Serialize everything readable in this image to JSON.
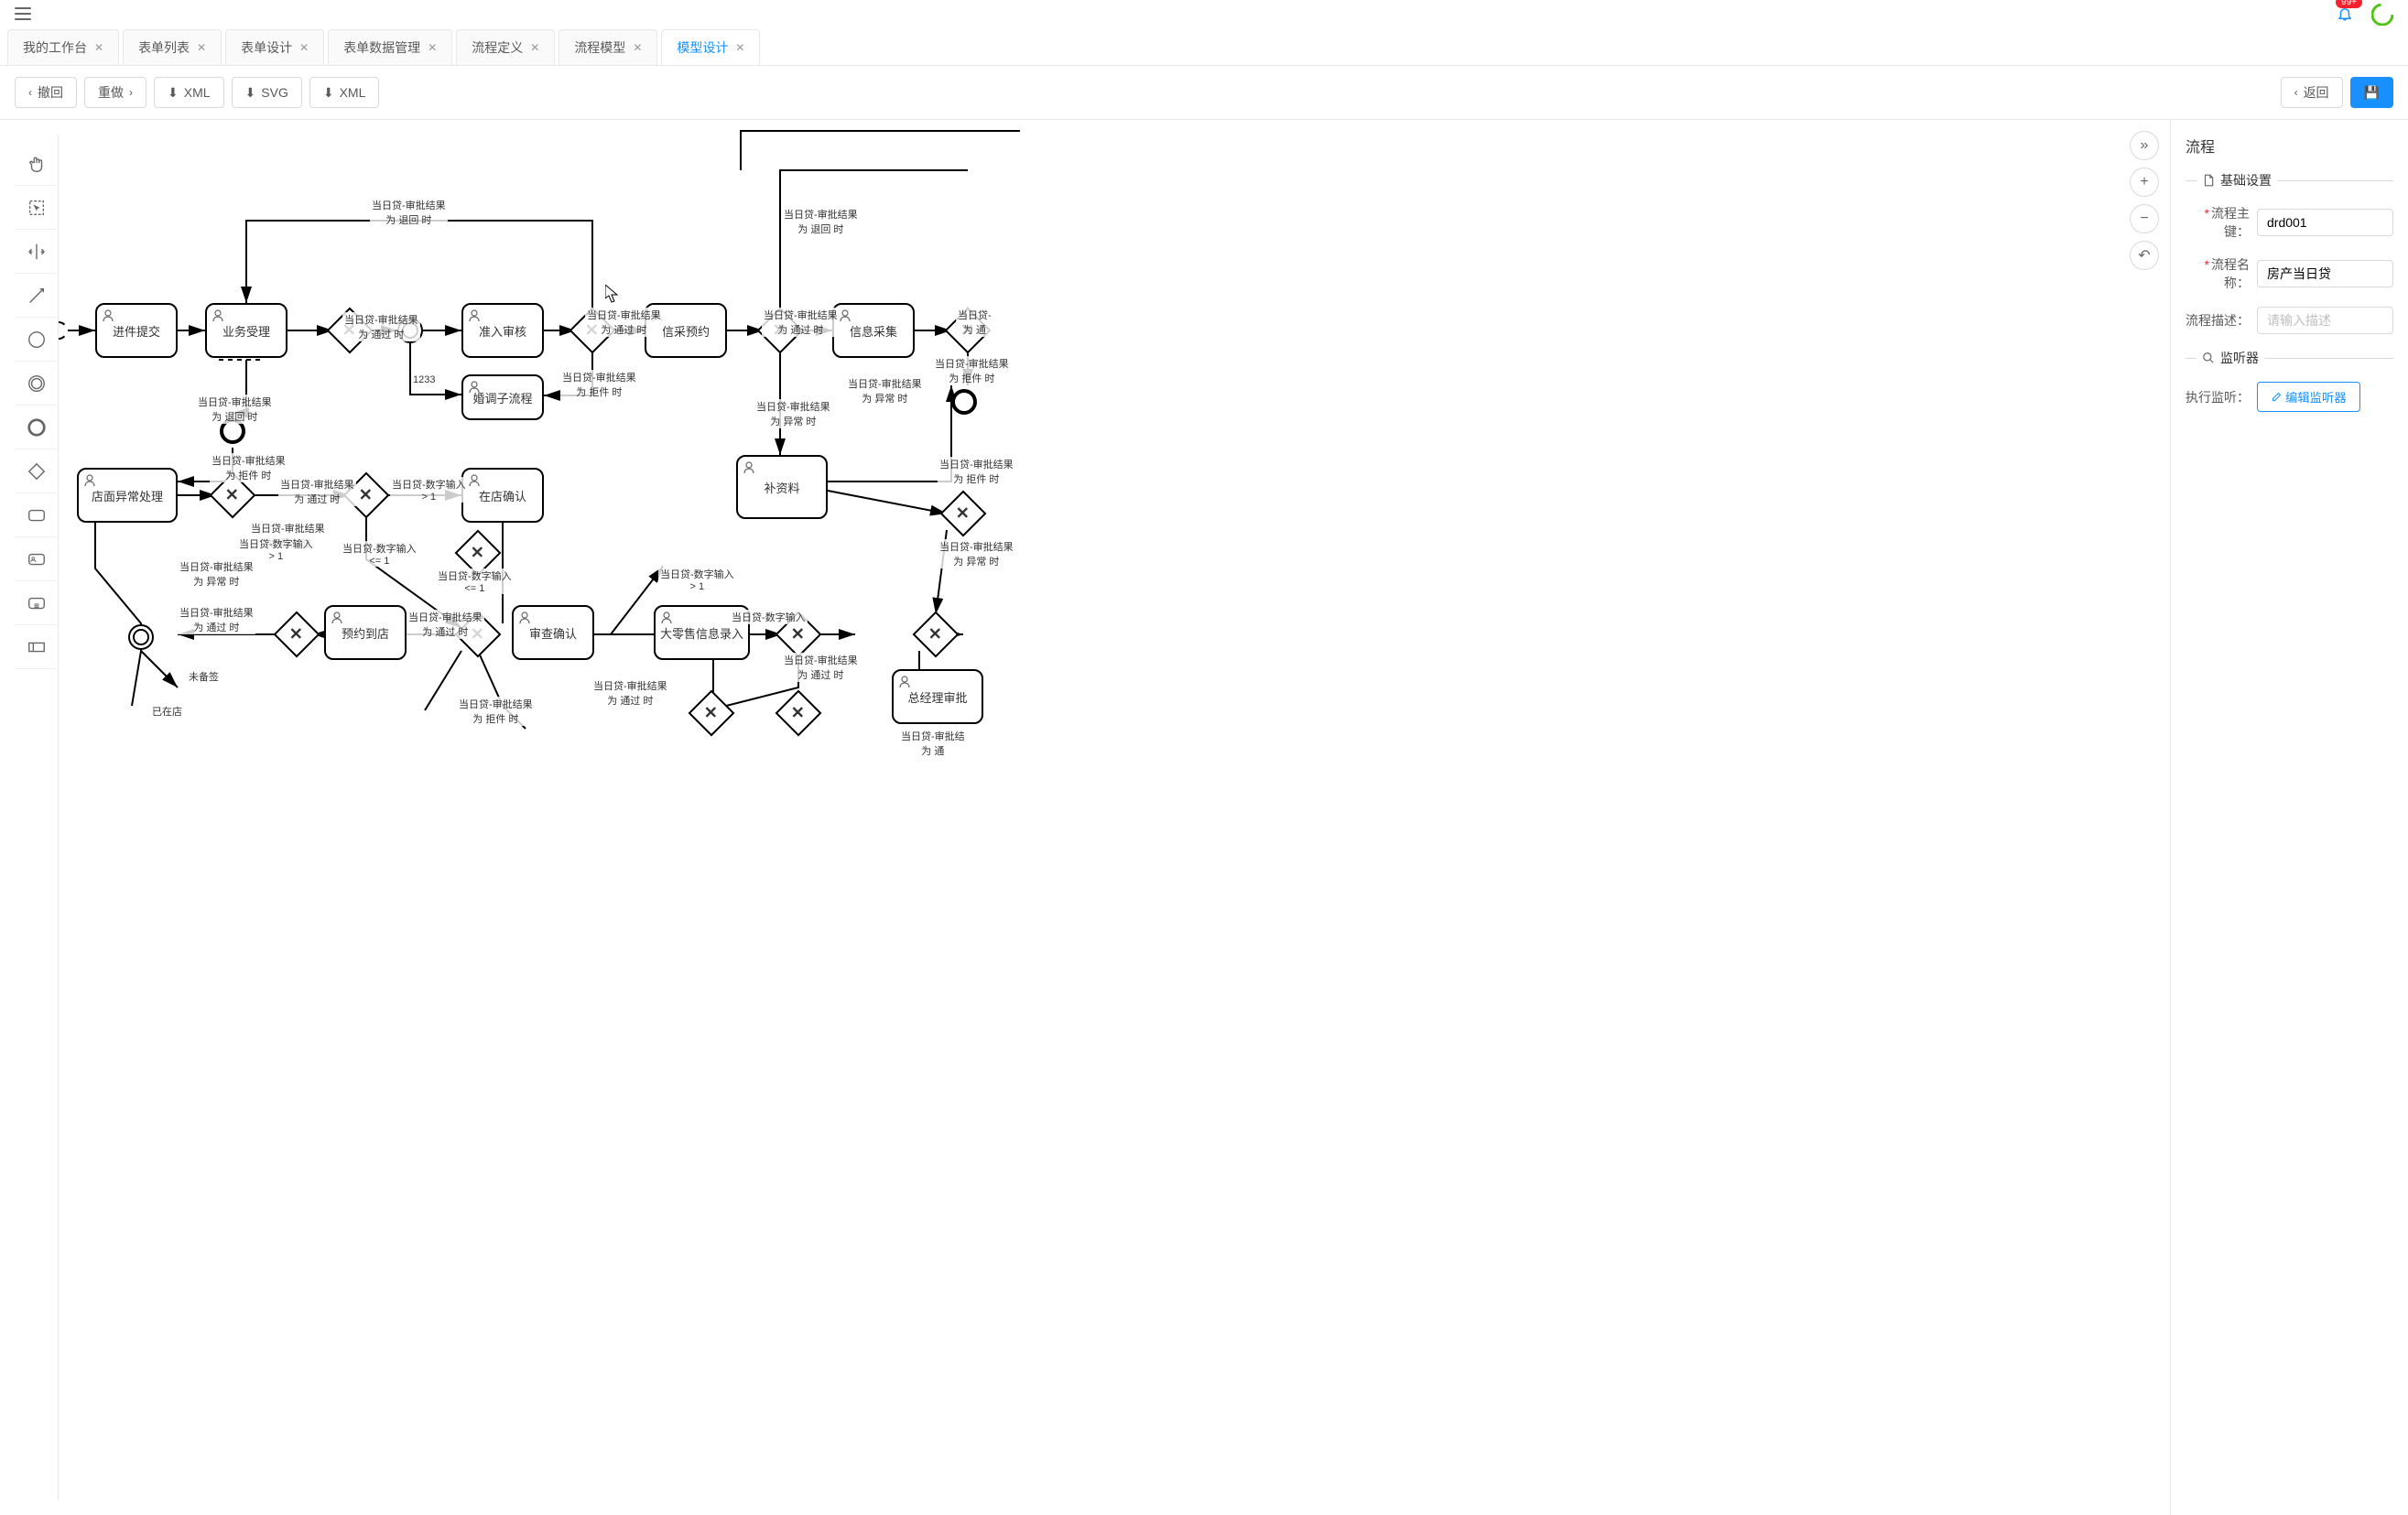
{
  "header": {
    "notification_badge": "99+"
  },
  "tabs": [
    {
      "label": "我的工作台",
      "closable": true,
      "active": false
    },
    {
      "label": "表单列表",
      "closable": true,
      "active": false
    },
    {
      "label": "表单设计",
      "closable": true,
      "active": false
    },
    {
      "label": "表单数据管理",
      "closable": true,
      "active": false
    },
    {
      "label": "流程定义",
      "closable": true,
      "active": false
    },
    {
      "label": "流程模型",
      "closable": true,
      "active": false
    },
    {
      "label": "模型设计",
      "closable": true,
      "active": true
    }
  ],
  "toolbar": {
    "undo": "撤回",
    "redo": "重做",
    "xml_download": "XML",
    "svg_download": "SVG",
    "xml_download2": "XML",
    "back": "返回"
  },
  "props": {
    "panel_title": "流程",
    "section_basic": "基础设置",
    "process_key_label": "流程主键：",
    "process_key_value": "drd001",
    "process_name_label": "流程名称：",
    "process_name_value": "房产当日贷",
    "process_desc_label": "流程描述：",
    "process_desc_placeholder": "请输入描述",
    "section_listener": "监听器",
    "exec_listener_label": "执行监听：",
    "edit_listener_btn": "编辑监听器"
  },
  "nodes": {
    "n1": "进件提交",
    "n2": "业务受理",
    "n3": "准入审核",
    "n4": "信采预约",
    "n5": "信息采集",
    "n6": "婚调子流程",
    "n7": "补资料",
    "n8": "店面异常处理",
    "n9": "在店确认",
    "n10": "预约到店",
    "n11": "审查确认",
    "n12": "大零售信息录入",
    "n13": "总经理审批"
  },
  "labels": {
    "l_return1": "当日贷-审批结果\n为 退回 时",
    "l_return2": "当日贷-审批结果\n为 退回 时",
    "l_return3": "当日贷-审批结果\n为 退回 时",
    "l_pass1": "当日贷-审批结果\n为 通过 时",
    "l_pass2": "当日贷-审批结果\n为 通过 时",
    "l_pass3": "当日贷-审批结果\n为 通过 时",
    "l_pass4": "当日贷-审批结果\n为 通过 时",
    "l_pass5": "当日贷-审批结果\n为 通过 时",
    "l_pass6": "当日贷-审批结果\n为 通过 时",
    "l_pass7": "当日贷-审批结果\n为 通过 时",
    "l_pass8": "当日贷-审批结果\n为 通过 时",
    "l_reject1": "当日贷-审批结果\n为 拒件 时",
    "l_reject2": "当日贷-审批结果\n为 拒件 时",
    "l_reject3": "当日贷-审批结果\n为 拒件 时",
    "l_reject4": "当日贷-审批结果\n为 拒件 时",
    "l_reject5": "当日贷-审批结果\n为 拒件 时",
    "l_abnormal1": "当日贷-审批结果\n为 异常 时",
    "l_abnormal2": "当日贷-审批结果\n为 异常 时",
    "l_abnormal3": "当日贷-审批结果\n为 异常 时",
    "l_num_gt1_a": "当日贷-数字输入\n> 1",
    "l_num_gt1_b": "当日贷-数字输入\n> 1",
    "l_num_gt1_c": "当日贷-数字输入\n> 1",
    "l_num_lte1_a": "当日贷-数字输入\n<= 1",
    "l_num_lte1_b": "当日贷-数字输入\n<= 1",
    "l_num_input": "当日贷-数字输入",
    "l_1233": "1233",
    "l_unprepared": "未备签",
    "l_instore": "已在店",
    "l_tong": "当日贷-审批结\n为 通",
    "l_tong2": "当日贷-\n为 通"
  }
}
